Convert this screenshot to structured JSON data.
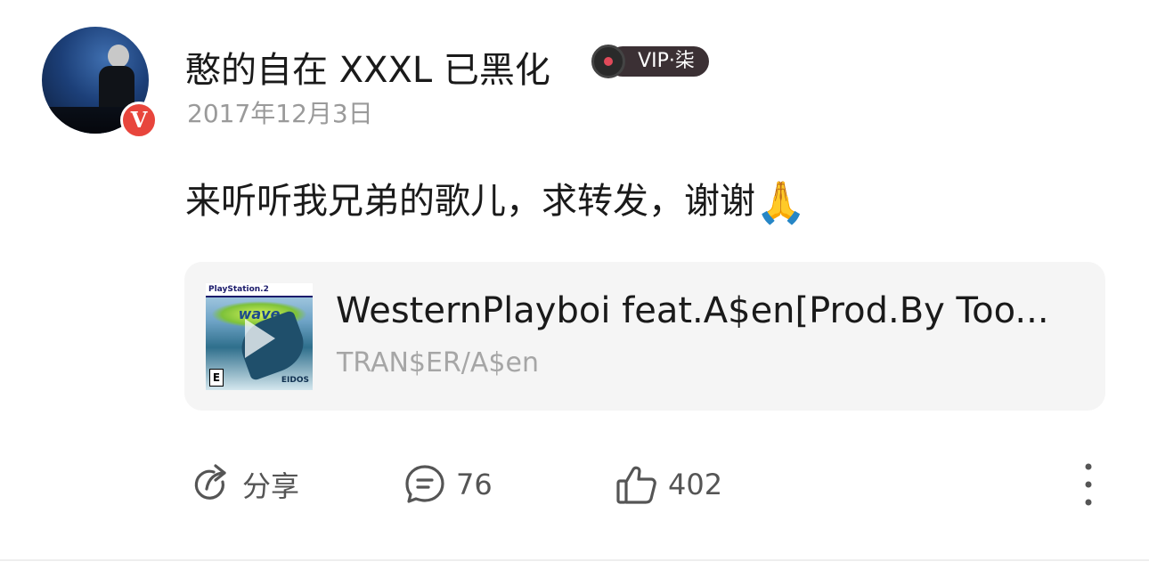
{
  "post": {
    "author": {
      "name": "憨的自在 XXXL 已黑化",
      "verified_badge": "V",
      "vip_label": "VIP·柒"
    },
    "date": "2017年12月3日",
    "text": "来听听我兄弟的歌儿，求转发，谢谢",
    "emoji": "🙏"
  },
  "music_card": {
    "title": "WesternPlayboi feat.A$en[Prod.By Too...",
    "artist": "TRAN$ER/A$en",
    "cover": {
      "platform_text": "PlayStation.2",
      "logo_text": "wave",
      "rating": "E",
      "brand": "EIDOS"
    }
  },
  "actions": {
    "share_label": "分享",
    "comment_count": "76",
    "like_count": "402"
  },
  "colors": {
    "badge_red": "#e8453c",
    "vip_pill": "#3b3034",
    "muted_text": "#9a9a9a",
    "card_bg": "#f5f5f5"
  },
  "icons": {
    "share": "share-arrow-icon",
    "comment": "comment-bubble-icon",
    "like": "thumbs-up-icon",
    "more": "more-vertical-icon",
    "vip": "vinyl-disc-icon"
  }
}
